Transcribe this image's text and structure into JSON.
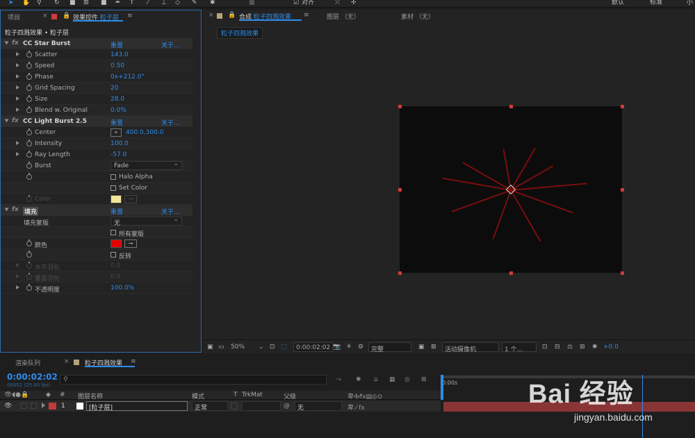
{
  "toolbar": {
    "align_label": "对齐",
    "workspace_default": "默认",
    "workspace_standard": "标准",
    "workspace_small": "小"
  },
  "effects_panel": {
    "tab_project": "项目",
    "tab_effects_prefix": "效果控件",
    "tab_effects_layer": "粒子层",
    "breadcrumb": "粒子四溅效果 • 粒子层",
    "reset_label": "重置",
    "about_label": "关于...",
    "effects": [
      {
        "name": "CC Star Burst",
        "props": [
          {
            "label": "Scatter",
            "value": "143.0"
          },
          {
            "label": "Speed",
            "value": "0.50"
          },
          {
            "label": "Phase",
            "value": "0x+212.0°"
          },
          {
            "label": "Grid Spacing",
            "value": "20"
          },
          {
            "label": "Size",
            "value": "28.0"
          },
          {
            "label": "Blend w. Original",
            "value": "0.0%"
          }
        ]
      },
      {
        "name": "CC Light Burst 2.5",
        "center_label": "Center",
        "center_value": "400.0,300.0",
        "intensity_label": "Intensity",
        "intensity_value": "100.0",
        "ray_label": "Ray Length",
        "ray_value": "-57.0",
        "burst_label": "Burst",
        "burst_value": "Fade",
        "halo_alpha_label": "Halo Alpha",
        "set_color_label": "Set Color",
        "color_label": "Color",
        "color_swatch": "#f5e59a"
      },
      {
        "name": "填充",
        "mask_label": "填充蒙版",
        "mask_value": "无",
        "all_masks_label": "所有蒙版",
        "color_label": "颜色",
        "color_swatch": "#e00000",
        "invert_label": "反转",
        "h_feather_label": "水平羽化",
        "h_feather_value": "0.0",
        "v_feather_label": "垂直羽化",
        "v_feather_value": "0.0",
        "opacity_label": "不透明度",
        "opacity_value": "100.0%"
      }
    ]
  },
  "viewer": {
    "tab_comp_prefix": "合成",
    "tab_comp_name": "粒子四溅效果",
    "tab_layer": "图层 （无）",
    "tab_footage": "素材 （无）",
    "comp_subtab": "粒子四溅效果",
    "zoom": "50%",
    "timecode": "0:00:02:02",
    "resolution": "完整",
    "camera": "活动摄像机",
    "views": "1 个...",
    "exposure": "+0.0"
  },
  "timeline": {
    "tab_render": "渲染队列",
    "tab_comp": "粒子四溅效果",
    "timecode": "0:00:02:02",
    "frame_info": "00052 (25.00 fps)",
    "search_placeholder": "",
    "col_layer_name": "图层名称",
    "col_mode": "模式",
    "col_t": "T",
    "col_trkmat": "TrkMat",
    "col_parent": "父级",
    "col_num": "#",
    "ruler_start": "0:00s",
    "layer": {
      "num": "1",
      "name": "[粒子层]",
      "mode": "正常",
      "parent": "无",
      "color": "#c23a3a"
    }
  },
  "watermark": {
    "text": "Bai 经验",
    "url": "jingyan.baidu.com"
  }
}
